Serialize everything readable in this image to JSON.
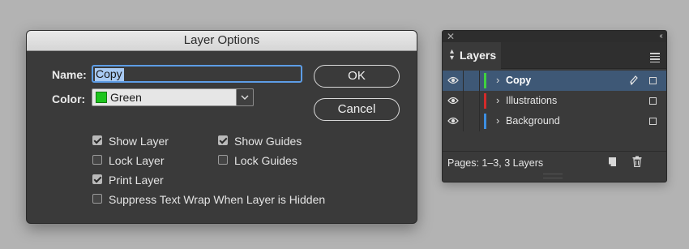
{
  "dialog": {
    "title": "Layer Options",
    "name_label": "Name:",
    "name_value": "Copy",
    "color_label": "Color:",
    "color_value": "Green",
    "color_swatch": "#1ec51e",
    "ok_label": "OK",
    "cancel_label": "Cancel",
    "checkboxes": [
      {
        "label": "Show Layer",
        "checked": true
      },
      {
        "label": "Show Guides",
        "checked": true
      },
      {
        "label": "Lock Layer",
        "checked": false
      },
      {
        "label": "Lock Guides",
        "checked": false
      },
      {
        "label": "Print Layer",
        "checked": true
      },
      {
        "label": "Suppress Text Wrap When Layer is Hidden",
        "checked": false
      }
    ]
  },
  "layers_panel": {
    "close_icon": "close-icon",
    "collapse_icon": "collapse-icon",
    "tab_label": "Layers",
    "layers": [
      {
        "name": "Copy",
        "color": "#3fd23f",
        "selected": true
      },
      {
        "name": "Illustrations",
        "color": "#d42a2a",
        "selected": false
      },
      {
        "name": "Background",
        "color": "#3d8ee0",
        "selected": false
      }
    ],
    "footer_text": "Pages: 1–3, 3 Layers"
  }
}
